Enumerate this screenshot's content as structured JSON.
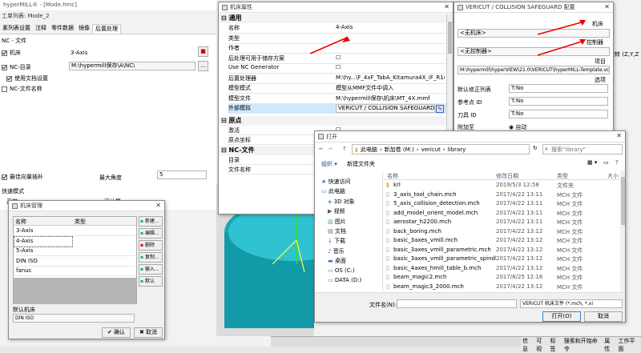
{
  "main": {
    "title": "hyperMILL® - [Mode.hmc]",
    "job_list": "工单列表:  Mode_2",
    "tabs": [
      "素列表设置",
      "注释",
      "零件数据",
      "镜像",
      "后置处理"
    ],
    "nc_file_label": "NC - 文件",
    "machine_label": "机床",
    "machine_value": "3-Axis",
    "nc_dir_label": "NC-目录",
    "nc_dir_value": "M:\\hypermill保存\\A\\NC\\",
    "use_doc_settings": "使用文档设置",
    "nc_file_name": "NC-文件名称",
    "max_interp_label": "最佳向量插补",
    "max_angle_label": "最大角度",
    "max_angle_value": "5",
    "fast_mode_label": "快速模式",
    "normal_label": "正常",
    "calc_label": "已计算"
  },
  "machine_props": {
    "title": "机床属性",
    "sections": [
      "通用",
      "原点",
      "NC-文件"
    ],
    "general_rows": [
      {
        "label": "名称",
        "value": "4-Axis"
      },
      {
        "label": "类型",
        "value": ""
      },
      {
        "label": "作者",
        "value": ""
      },
      {
        "label": "后处理可用于储存方案",
        "value": "☐"
      },
      {
        "label": "Use NC Generator",
        "value": "☐"
      },
      {
        "label": "后置处理器",
        "value": "M:\\hy...\\F_4xF_TabA_Kitamura4X_iF_R1c.oma"
      },
      {
        "label": "模型模式",
        "value": "模型从MMF文件中调入"
      },
      {
        "label": "模型文件",
        "value": "M:\\hypermill保存\\机床\\MT_4X.mmf"
      },
      {
        "label": "外部模拟",
        "value": "VERICUT / COLLISION SAFEGUARD"
      }
    ],
    "origin_rows": [
      {
        "label": "激活",
        "value": "☐"
      },
      {
        "label": "原点坐标",
        "value": "☐"
      }
    ],
    "nc_rows": [
      {
        "label": "目录",
        "value": ""
      },
      {
        "label": "文件名称",
        "value": ""
      }
    ]
  },
  "vericut": {
    "title": "VERICUT / COLLISION SAFEGUARD 配置",
    "machine_label": "机床",
    "machine_value": "<无机床>",
    "controller_label": "控制器",
    "controller_value": "<无控制器>",
    "project_label": "项目",
    "project_value": "M:\\hypermill\\hyperVIEW\\21.0\\VERICUT\\hyperMILL-Template.vcproject",
    "options_label": "选项",
    "rows": [
      {
        "label": "默认修正列表",
        "value": "T:No"
      },
      {
        "label": "参考点 ID",
        "value": "T:No"
      },
      {
        "label": "刀具 ID",
        "value": "T:No"
      }
    ],
    "attach_label": "附加至",
    "auto_label": "自动"
  },
  "machine_mgr": {
    "title": "机床管理",
    "col_name": "名称",
    "col_type": "类型",
    "items": [
      "3-Axis",
      "4-Axis",
      "5-Axis",
      "DIN ISO",
      "fanuc"
    ],
    "buttons": [
      "新建...",
      "编辑...",
      "删除",
      "复制...",
      "输入...",
      "默认"
    ],
    "default_label": "默认机床",
    "default_value": "DIN ISO",
    "ok": "确认",
    "cancel": "取消"
  },
  "open_dialog": {
    "title": "打开",
    "breadcrumb": [
      "此电脑",
      "新加卷 (M:)",
      "vericut",
      "library"
    ],
    "search_placeholder": "搜索\"library\"",
    "organize": "组织 ▾",
    "new_folder": "新建文件夹",
    "cols": [
      "名称",
      "修改日期",
      "类型",
      "大小"
    ],
    "nav": [
      {
        "label": "快速访问",
        "icon": "star-icon"
      },
      {
        "label": "此电脑",
        "icon": "computer-icon"
      },
      {
        "label": "3D 对象",
        "icon": "cube-icon"
      },
      {
        "label": "视频",
        "icon": "video-icon"
      },
      {
        "label": "图片",
        "icon": "picture-icon"
      },
      {
        "label": "文档",
        "icon": "document-icon"
      },
      {
        "label": "下载",
        "icon": "download-icon"
      },
      {
        "label": "音乐",
        "icon": "music-icon"
      },
      {
        "label": "桌面",
        "icon": "desktop-icon"
      },
      {
        "label": "OS (C:)",
        "icon": "drive-icon"
      },
      {
        "label": "DATA (D:)",
        "icon": "drive-icon"
      }
    ],
    "files": [
      {
        "name": "krl",
        "date": "2019/5/3 12:58",
        "type": "文件夹",
        "folder": true
      },
      {
        "name": "3_axis_tool_chain.mch",
        "date": "2017/4/22 13:11",
        "type": "MCH 文件"
      },
      {
        "name": "5_axis_collision_detection.mch",
        "date": "2017/4/22 13:11",
        "type": "MCH 文件"
      },
      {
        "name": "add_model_orient_model.mch",
        "date": "2017/4/22 13:11",
        "type": "MCH 文件"
      },
      {
        "name": "aerostar_h2200.mch",
        "date": "2017/4/22 13:11",
        "type": "MCH 文件"
      },
      {
        "name": "back_boring.mch",
        "date": "2017/4/22 13:12",
        "type": "MCH 文件"
      },
      {
        "name": "basic_3axes_vmill.mch",
        "date": "2017/4/22 13:12",
        "type": "MCH 文件"
      },
      {
        "name": "basic_3axes_vmill_parametric.mch",
        "date": "2017/4/22 13:12",
        "type": "MCH 文件"
      },
      {
        "name": "basic_3axes_vmill_parametric_spindl...",
        "date": "2017/4/22 13:12",
        "type": "MCH 文件"
      },
      {
        "name": "basic_4axes_hmill_table_b.mch",
        "date": "2017/4/22 13:12",
        "type": "MCH 文件"
      },
      {
        "name": "beam_magic2.mch",
        "date": "2017/8/25 12:16",
        "type": "MCH 文件"
      },
      {
        "name": "beam_magic3_2000.mch",
        "date": "2017/4/22 13:12",
        "type": "MCH 文件"
      }
    ],
    "filename_label": "文件名(N):",
    "filter_value": "VERICUT 机床文件 (*.mch, *.xi",
    "open_btn": "打开(O)",
    "cancel_btn": "取消"
  },
  "statusbar": {
    "items": [
      "信息",
      "可视",
      "标签",
      "搜索和开始命令",
      "属性",
      "工作平面"
    ]
  },
  "right_edge": {
    "label": "旋转 (Z,Y,Z"
  }
}
